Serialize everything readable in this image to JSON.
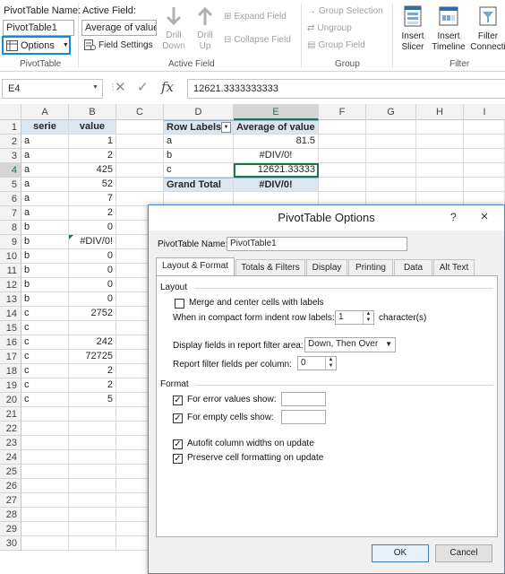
{
  "ribbon": {
    "pivot_name_label": "PivotTable Name:",
    "pivot_name_value": "PivotTable1",
    "options_label": "Options",
    "group_pivottable": "PivotTable",
    "active_field_label": "Active Field:",
    "active_field_value": "Average of value",
    "field_settings_label": "Field Settings",
    "drill_down": "Drill\nDown",
    "drill_up": "Drill\nUp",
    "expand_field": "Expand Field",
    "collapse_field": "Collapse Field",
    "group_active_field": "Active Field",
    "group_selection": "Group Selection",
    "ungroup": "Ungroup",
    "group_field": "Group Field",
    "group_group": "Group",
    "insert_slicer": "Insert\nSlicer",
    "insert_timeline": "Insert\nTimeline",
    "filter_connections": "Filter\nConnecti",
    "group_filter": "Filter"
  },
  "formula_bar": {
    "name_box": "E4",
    "fx": "fx",
    "formula": "12621.3333333333"
  },
  "columns": [
    "A",
    "B",
    "C",
    "D",
    "E",
    "F",
    "G",
    "H",
    "I"
  ],
  "rows": [
    "1",
    "2",
    "3",
    "4",
    "5",
    "6",
    "7",
    "8",
    "9",
    "10",
    "11",
    "12",
    "13",
    "14",
    "15",
    "16",
    "17",
    "18",
    "19",
    "20",
    "21",
    "22",
    "23",
    "24",
    "25",
    "26",
    "27",
    "28",
    "29",
    "30"
  ],
  "table": {
    "header_serie": "serie",
    "header_value": "value",
    "data": [
      [
        "a",
        "1"
      ],
      [
        "a",
        "2"
      ],
      [
        "a",
        "425"
      ],
      [
        "a",
        "52"
      ],
      [
        "a",
        "7"
      ],
      [
        "a",
        "2"
      ],
      [
        "b",
        "0"
      ],
      [
        "b",
        "#DIV/0!"
      ],
      [
        "b",
        "0"
      ],
      [
        "b",
        "0"
      ],
      [
        "b",
        "0"
      ],
      [
        "b",
        "0"
      ],
      [
        "c",
        "2752"
      ],
      [
        "c",
        ""
      ],
      [
        "c",
        "242"
      ],
      [
        "c",
        "72725"
      ],
      [
        "c",
        "2"
      ],
      [
        "c",
        "2"
      ],
      [
        "c",
        "5"
      ]
    ]
  },
  "pivot": {
    "row_labels": "Row Labels",
    "avg_header": "Average of value",
    "rows": [
      [
        "a",
        "81.5"
      ],
      [
        "b",
        "#DIV/0!"
      ],
      [
        "c",
        "12621.33333"
      ]
    ],
    "grand_total_label": "Grand Total",
    "grand_total_value": "#DIV/0!"
  },
  "dialog": {
    "title": "PivotTable Options",
    "help": "?",
    "close": "×",
    "name_label": "PivotTable Name:",
    "name_value": "PivotTable1",
    "tabs": [
      "Layout & Format",
      "Totals & Filters",
      "Display",
      "Printing",
      "Data",
      "Alt Text"
    ],
    "layout_section": "Layout",
    "merge_center": "Merge and center cells with labels",
    "indent_label": "When in compact form indent row labels:",
    "indent_value": "1",
    "indent_unit": "character(s)",
    "display_fields_label": "Display fields in report filter area:",
    "display_fields_value": "Down, Then Over",
    "report_filter_label": "Report filter fields per column:",
    "report_filter_value": "0",
    "format_section": "Format",
    "error_values": "For error values show:",
    "empty_cells": "For empty cells show:",
    "autofit": "Autofit column widths on update",
    "preserve": "Preserve cell formatting on update",
    "ok": "OK",
    "cancel": "Cancel"
  },
  "colors": {
    "accent_blue": "#0078d7",
    "pivot_header_blue": "#dce6f1",
    "excel_green": "#217346"
  }
}
